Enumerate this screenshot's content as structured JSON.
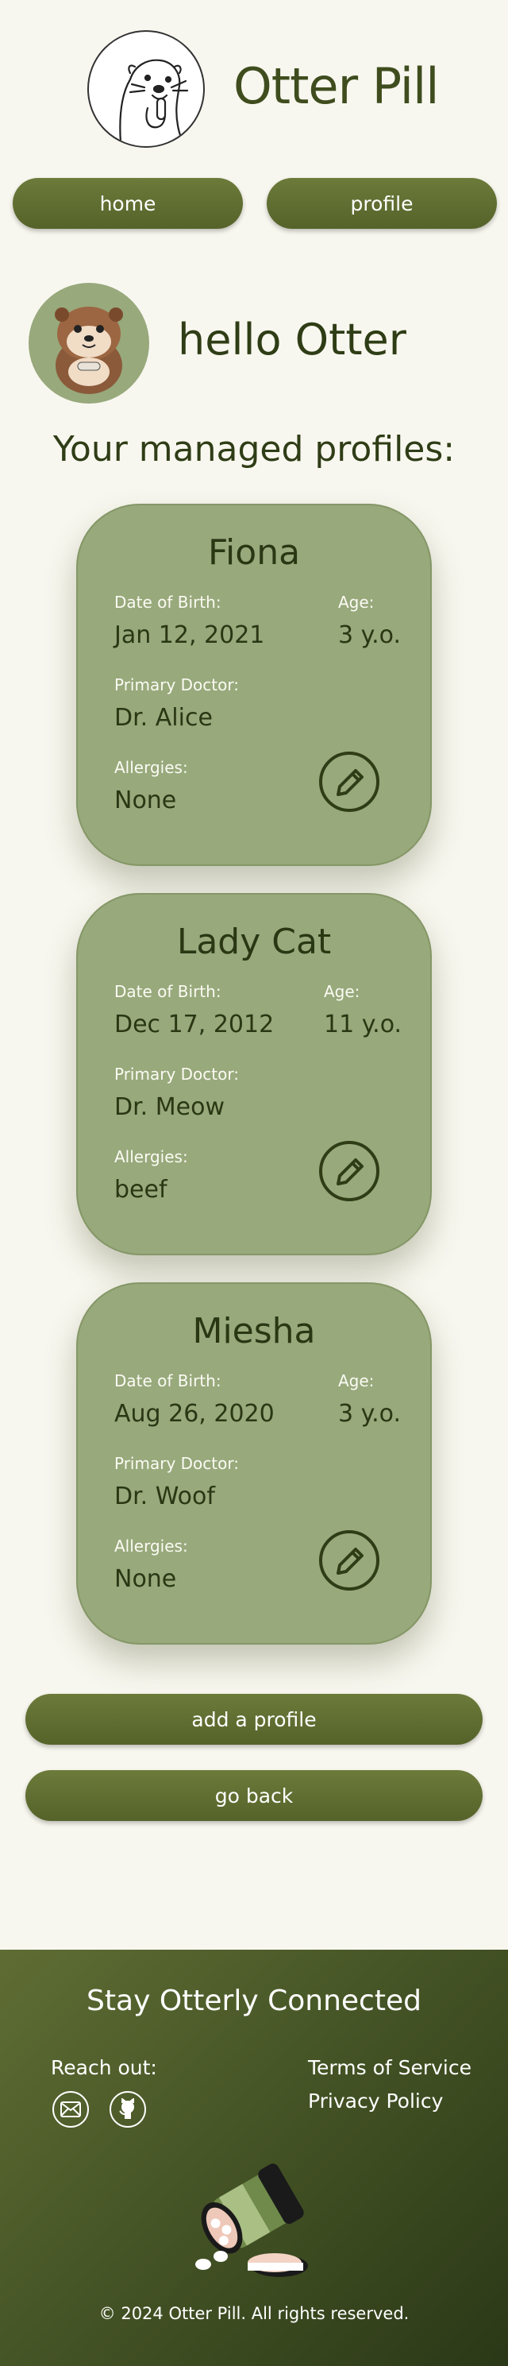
{
  "app": {
    "title": "Otter Pill"
  },
  "nav": {
    "home_label": "home",
    "profile_label": "profile"
  },
  "greeting": {
    "text": "hello Otter"
  },
  "section": {
    "title": "Your managed profiles:"
  },
  "labels": {
    "dob": "Date of Birth:",
    "age": "Age:",
    "doctor": "Primary Doctor:",
    "allergies": "Allergies:"
  },
  "profiles": [
    {
      "name": "Fiona",
      "dob": "Jan 12, 2021",
      "age": "3 y.o.",
      "doctor": "Dr. Alice",
      "allergies": "None"
    },
    {
      "name": "Lady Cat",
      "dob": "Dec 17, 2012",
      "age": "11 y.o.",
      "doctor": "Dr. Meow",
      "allergies": "beef"
    },
    {
      "name": "Miesha",
      "dob": "Aug 26, 2020",
      "age": "3 y.o.",
      "doctor": "Dr. Woof",
      "allergies": "None"
    }
  ],
  "actions": {
    "add_label": "add a profile",
    "back_label": "go back"
  },
  "footer": {
    "title": "Stay Otterly Connected",
    "reach_out": "Reach out:",
    "terms": "Terms of Service",
    "privacy": "Privacy Policy",
    "copyright": "© 2024 Otter Pill. All rights reserved."
  },
  "icons": [
    "otter-logo-icon",
    "otter-avatar-icon",
    "edit-pencil-icon",
    "mail-icon",
    "github-icon",
    "pill-bottle-icon"
  ],
  "colors": {
    "accent": "#5f6d30",
    "card": "#98a97c",
    "background": "#f8f7ef",
    "text": "#2f3d16"
  }
}
